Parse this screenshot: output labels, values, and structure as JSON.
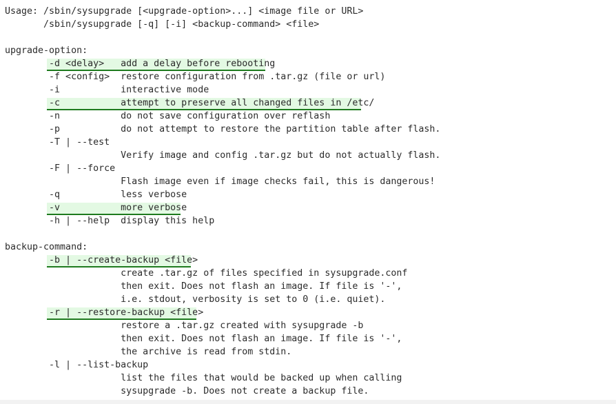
{
  "terminal": {
    "lines": [
      "Usage: /sbin/sysupgrade [<upgrade-option>...] <image file or URL>",
      "       /sbin/sysupgrade [-q] [-i] <backup-command> <file>",
      "",
      "upgrade-option:",
      "        -d <delay>   add a delay before rebooting",
      "        -f <config>  restore configuration from .tar.gz (file or url)",
      "        -i           interactive mode",
      "        -c           attempt to preserve all changed files in /etc/",
      "        -n           do not save configuration over reflash",
      "        -p           do not attempt to restore the partition table after flash.",
      "        -T | --test",
      "                     Verify image and config .tar.gz but do not actually flash.",
      "        -F | --force",
      "                     Flash image even if image checks fail, this is dangerous!",
      "        -q           less verbose",
      "        -v           more verbose",
      "        -h | --help  display this help",
      "",
      "backup-command:",
      "        -b | --create-backup <file>",
      "                     create .tar.gz of files specified in sysupgrade.conf",
      "                     then exit. Does not flash an image. If file is '-',",
      "                     i.e. stdout, verbosity is set to 0 (i.e. quiet).",
      "        -r | --restore-backup <file>",
      "                     restore a .tar.gz created with sysupgrade -b",
      "                     then exit. Does not flash an image. If file is '-',",
      "                     the archive is read from stdin.",
      "        -l | --list-backup",
      "                     list the files that would be backed up when calling",
      "                     sysupgrade -b. Does not create a backup file."
    ],
    "highlights": [
      {
        "line": 4,
        "text": "-d <delay>   add a delay before rebooting"
      },
      {
        "line": 7,
        "text": "-c           attempt to preserve all changed files in /etc/"
      },
      {
        "line": 15,
        "text": "-v           more verbose"
      },
      {
        "line": 19,
        "text": "-b | --create-backup <file>"
      },
      {
        "line": 23,
        "text": "-r | --restore-backup <file>"
      }
    ],
    "colors": {
      "text": "#2b2b2b",
      "background": "#ffffff",
      "highlight_fill": "#e3f9e3",
      "highlight_underline": "#1e7a1e"
    }
  }
}
